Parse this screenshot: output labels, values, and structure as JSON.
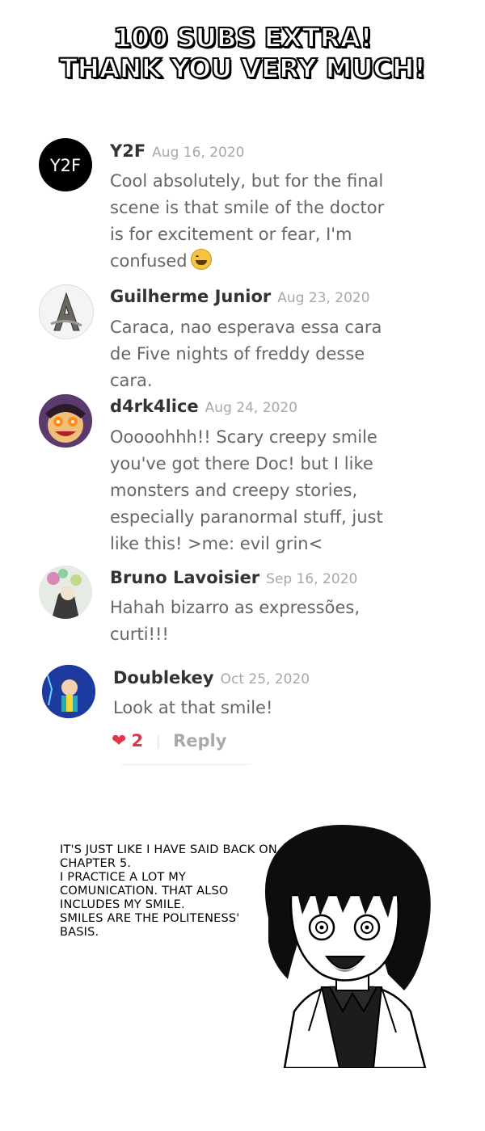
{
  "title": {
    "line1": "100 SUBS EXTRA!",
    "line2": "THANK YOU VERY MUCH!"
  },
  "comments": [
    {
      "author": "Y2F",
      "date": "Aug 16, 2020",
      "text": "Cool absolutely, but for the final scene is that smile of the doctor is for excitement or fear, I'm confused",
      "avatar_text": "Y2F",
      "emoji": "sweat-smile-emoji"
    },
    {
      "author": "Guilherme Junior",
      "date": "Aug 23, 2020",
      "text": "Caraca, nao esperava essa cara de Five nights of freddy desse cara."
    },
    {
      "author": "d4rk4lice",
      "date": "Aug 24, 2020",
      "text": "Ooooohhh!! Scary creepy smile you've got there Doc! but I like monsters and creepy stories, especially paranormal stuff, just like this! >me: evil grin<"
    },
    {
      "author": "Bruno Lavoisier",
      "date": "Sep 16, 2020",
      "text": "Hahah bizarro as expressões, curti!!!"
    },
    {
      "author": "Doublekey",
      "date": "Oct 25, 2020",
      "text": "Look at that smile!",
      "likes": "2",
      "reply_label": "Reply"
    }
  ],
  "speech_bubble": "It's just like I have said back on chapter 5.\n I practice a lot my comunication. That also includes my smile.\n Smiles are the politeness' basis.",
  "colors": {
    "author": "#333333",
    "date": "#a8a8a8",
    "text": "#666666",
    "like": "#e0364a"
  }
}
